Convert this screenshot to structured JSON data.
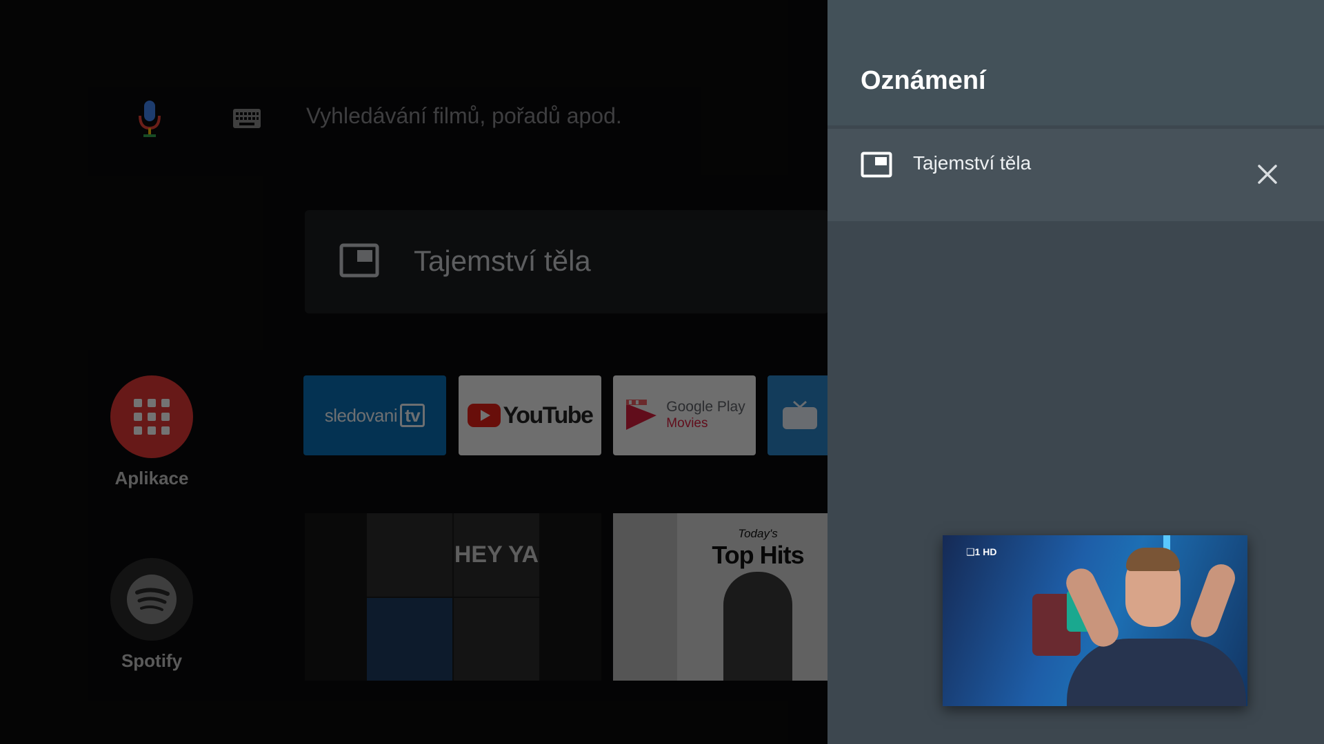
{
  "home": {
    "search": {
      "mic_icon": "mic-icon",
      "keyboard_icon": "keyboard-icon",
      "placeholder": "Vyhledávání filmů, pořadů apod."
    },
    "now_playing": {
      "icon": "picture-in-picture-icon",
      "title": "Tajemství těla"
    },
    "rail": [
      {
        "label": "Aplikace",
        "icon": "apps-grid-icon",
        "color": "#e53935"
      },
      {
        "label": "Spotify",
        "icon": "spotify-icon",
        "color": "#2a2a2a"
      }
    ],
    "app_tiles": {
      "sledovani": {
        "text": "sledovani",
        "box": "tv"
      },
      "youtube": {
        "text": "YouTube"
      },
      "google_play_movies": {
        "line1": "Google Play",
        "line2": "Movies"
      },
      "tv_tile_icon": "tv-icon"
    },
    "music": {
      "tile1_text": "HEY YA",
      "tile2_small": "Today's",
      "tile2_big": "Top Hits"
    }
  },
  "panel": {
    "title": "Oznámení",
    "notification": {
      "icon": "picture-in-picture-icon",
      "title": "Tajemství těla",
      "close_icon": "close-icon"
    },
    "pip_video": {
      "channel_logo": "❑1 HD"
    }
  },
  "colors": {
    "panel_bg": "#3d474f",
    "panel_header": "#435159",
    "notification_bg": "#47525a",
    "accent_red": "#e53935"
  }
}
